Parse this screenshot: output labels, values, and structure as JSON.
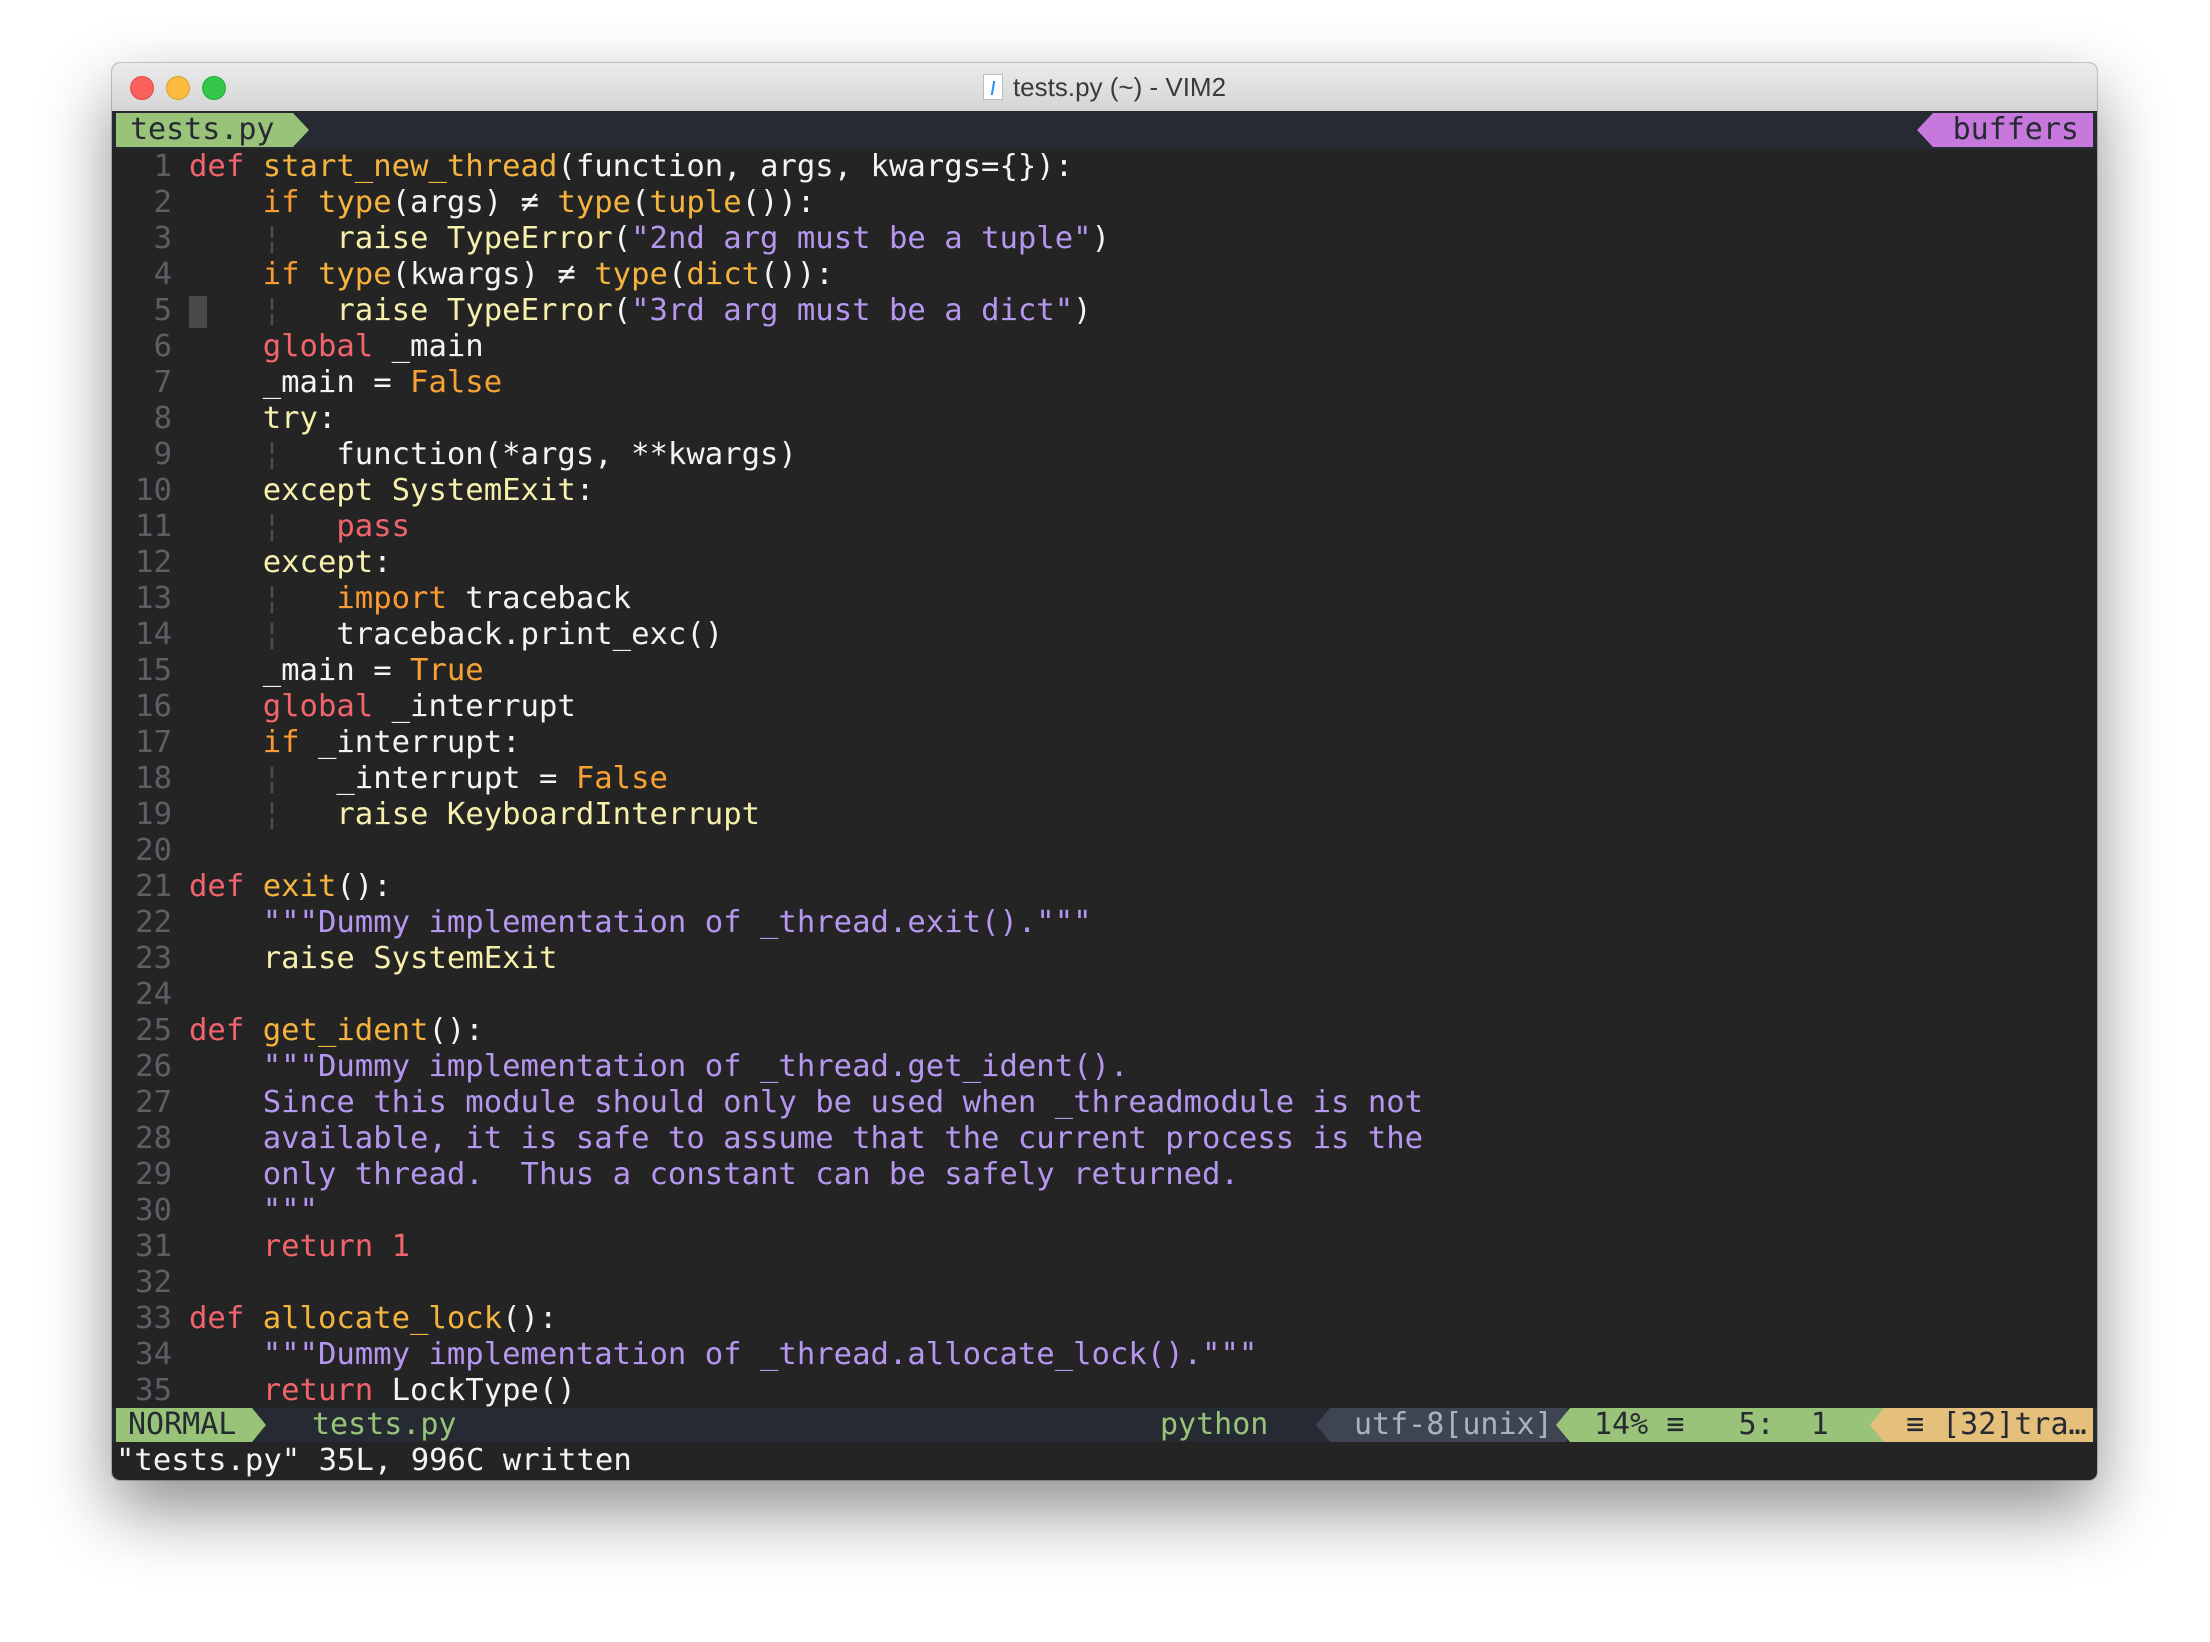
{
  "window": {
    "title": "tests.py (~) - VIM2"
  },
  "tabline": {
    "active_tab": "tests.py",
    "buffers_label": "buffers"
  },
  "colors": {
    "keyword": "#f2646c",
    "conditional": "#fa9a33",
    "function": "#f4b43e",
    "type": "#f7f0ad",
    "string": "#b697f0",
    "constant": "#f7a233",
    "tab_bg": "#98c379",
    "buffers_bg": "#c678dd",
    "warn_bg": "#e5c07b"
  },
  "editor": {
    "cursor_line": 5,
    "lines": [
      [
        [
          "k",
          "def"
        ],
        [
          "n",
          " "
        ],
        [
          "f",
          "start_new_thread"
        ],
        [
          "n",
          "(function, args, kwargs={}):"
        ]
      ],
      [
        [
          "n",
          "    "
        ],
        [
          "c",
          "if"
        ],
        [
          "n",
          " "
        ],
        [
          "f",
          "type"
        ],
        [
          "n",
          "(args) ≠ "
        ],
        [
          "f",
          "type"
        ],
        [
          "n",
          "("
        ],
        [
          "f",
          "tuple"
        ],
        [
          "n",
          "()):"
        ]
      ],
      [
        [
          "n",
          "    "
        ],
        [
          "g",
          "¦"
        ],
        [
          "n",
          "   "
        ],
        [
          "t",
          "raise"
        ],
        [
          "n",
          " "
        ],
        [
          "t",
          "TypeError"
        ],
        [
          "n",
          "("
        ],
        [
          "s",
          "\"2nd arg must be a tuple\""
        ],
        [
          "n",
          ")"
        ]
      ],
      [
        [
          "n",
          "    "
        ],
        [
          "c",
          "if"
        ],
        [
          "n",
          " "
        ],
        [
          "f",
          "type"
        ],
        [
          "n",
          "(kwargs) ≠ "
        ],
        [
          "f",
          "type"
        ],
        [
          "n",
          "("
        ],
        [
          "f",
          "dict"
        ],
        [
          "n",
          "()):"
        ]
      ],
      [
        [
          "n",
          "    "
        ],
        [
          "g",
          "¦"
        ],
        [
          "n",
          "   "
        ],
        [
          "t",
          "raise"
        ],
        [
          "n",
          " "
        ],
        [
          "t",
          "TypeError"
        ],
        [
          "n",
          "("
        ],
        [
          "s",
          "\"3rd arg must be a dict\""
        ],
        [
          "n",
          ")"
        ]
      ],
      [
        [
          "n",
          "    "
        ],
        [
          "k",
          "global"
        ],
        [
          "n",
          " _main"
        ]
      ],
      [
        [
          "n",
          "    _main = "
        ],
        [
          "b",
          "False"
        ]
      ],
      [
        [
          "n",
          "    "
        ],
        [
          "t",
          "try"
        ],
        [
          "n",
          ":"
        ]
      ],
      [
        [
          "n",
          "    "
        ],
        [
          "g",
          "¦"
        ],
        [
          "n",
          "   function(*args, **kwargs)"
        ]
      ],
      [
        [
          "n",
          "    "
        ],
        [
          "t",
          "except"
        ],
        [
          "n",
          " "
        ],
        [
          "t",
          "SystemExit"
        ],
        [
          "n",
          ":"
        ]
      ],
      [
        [
          "n",
          "    "
        ],
        [
          "g",
          "¦"
        ],
        [
          "n",
          "   "
        ],
        [
          "k",
          "pass"
        ]
      ],
      [
        [
          "n",
          "    "
        ],
        [
          "t",
          "except"
        ],
        [
          "n",
          ":"
        ]
      ],
      [
        [
          "n",
          "    "
        ],
        [
          "g",
          "¦"
        ],
        [
          "n",
          "   "
        ],
        [
          "c",
          "import"
        ],
        [
          "n",
          " traceback"
        ]
      ],
      [
        [
          "n",
          "    "
        ],
        [
          "g",
          "¦"
        ],
        [
          "n",
          "   traceback.print_exc()"
        ]
      ],
      [
        [
          "n",
          "    _main = "
        ],
        [
          "b",
          "True"
        ]
      ],
      [
        [
          "n",
          "    "
        ],
        [
          "k",
          "global"
        ],
        [
          "n",
          " _interrupt"
        ]
      ],
      [
        [
          "n",
          "    "
        ],
        [
          "c",
          "if"
        ],
        [
          "n",
          " _interrupt:"
        ]
      ],
      [
        [
          "n",
          "    "
        ],
        [
          "g",
          "¦"
        ],
        [
          "n",
          "   _interrupt = "
        ],
        [
          "b",
          "False"
        ]
      ],
      [
        [
          "n",
          "    "
        ],
        [
          "g",
          "¦"
        ],
        [
          "n",
          "   "
        ],
        [
          "t",
          "raise"
        ],
        [
          "n",
          " "
        ],
        [
          "t",
          "KeyboardInterrupt"
        ]
      ],
      [],
      [
        [
          "k",
          "def"
        ],
        [
          "n",
          " "
        ],
        [
          "f",
          "exit"
        ],
        [
          "n",
          "():"
        ]
      ],
      [
        [
          "n",
          "    "
        ],
        [
          "s",
          "\"\"\"Dummy implementation of _thread.exit().\"\"\""
        ]
      ],
      [
        [
          "n",
          "    "
        ],
        [
          "t",
          "raise"
        ],
        [
          "n",
          " "
        ],
        [
          "t",
          "SystemExit"
        ]
      ],
      [],
      [
        [
          "k",
          "def"
        ],
        [
          "n",
          " "
        ],
        [
          "f",
          "get_ident"
        ],
        [
          "n",
          "():"
        ]
      ],
      [
        [
          "n",
          "    "
        ],
        [
          "s",
          "\"\"\"Dummy implementation of _thread.get_ident()."
        ]
      ],
      [
        [
          "n",
          "    "
        ],
        [
          "s",
          "Since this module should only be used when _threadmodule is not"
        ]
      ],
      [
        [
          "n",
          "    "
        ],
        [
          "s",
          "available, it is safe to assume that the current process is the"
        ]
      ],
      [
        [
          "n",
          "    "
        ],
        [
          "s",
          "only thread.  Thus a constant can be safely returned."
        ]
      ],
      [
        [
          "n",
          "    "
        ],
        [
          "s",
          "\"\"\""
        ]
      ],
      [
        [
          "n",
          "    "
        ],
        [
          "k",
          "return"
        ],
        [
          "n",
          " "
        ],
        [
          "k",
          "1"
        ]
      ],
      [],
      [
        [
          "k",
          "def"
        ],
        [
          "n",
          " "
        ],
        [
          "f",
          "allocate_lock"
        ],
        [
          "n",
          "():"
        ]
      ],
      [
        [
          "n",
          "    "
        ],
        [
          "s",
          "\"\"\"Dummy implementation of _thread.allocate_lock().\"\"\""
        ]
      ],
      [
        [
          "n",
          "    "
        ],
        [
          "k",
          "return"
        ],
        [
          "n",
          " LockType()"
        ]
      ]
    ]
  },
  "statusline": {
    "mode": "NORMAL",
    "filename": "tests.py",
    "filetype": "python",
    "encoding": "utf-8[unix]",
    "percent": "14% ≡",
    "position": "5:  1",
    "warning": "≡ [32]tra…"
  },
  "cmdline": {
    "message": "\"tests.py\" 35L, 996C written"
  }
}
